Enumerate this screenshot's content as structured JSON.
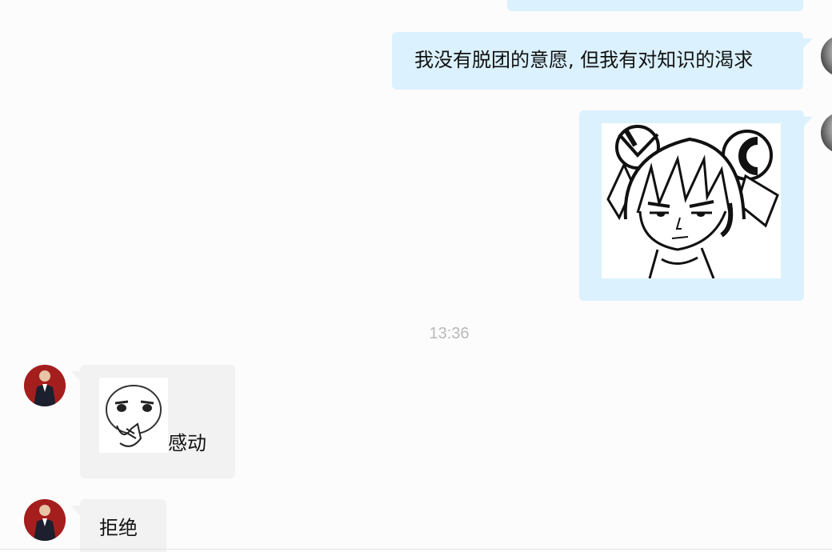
{
  "messages": {
    "outgoing_text": "我没有脱团的意愿, 但我有对知识的渴求",
    "outgoing_sticker": "anime-girl-sticker",
    "timestamp": "13:36",
    "incoming_1_text": "感动",
    "incoming_1_sticker": "touched-face-sticker",
    "incoming_2_text": "拒绝"
  },
  "colors": {
    "outgoing_bubble": "#dbf1fd",
    "incoming_bubble": "#f2f2f2",
    "timestamp": "#b9b9b9",
    "background": "#fcfcfc"
  }
}
